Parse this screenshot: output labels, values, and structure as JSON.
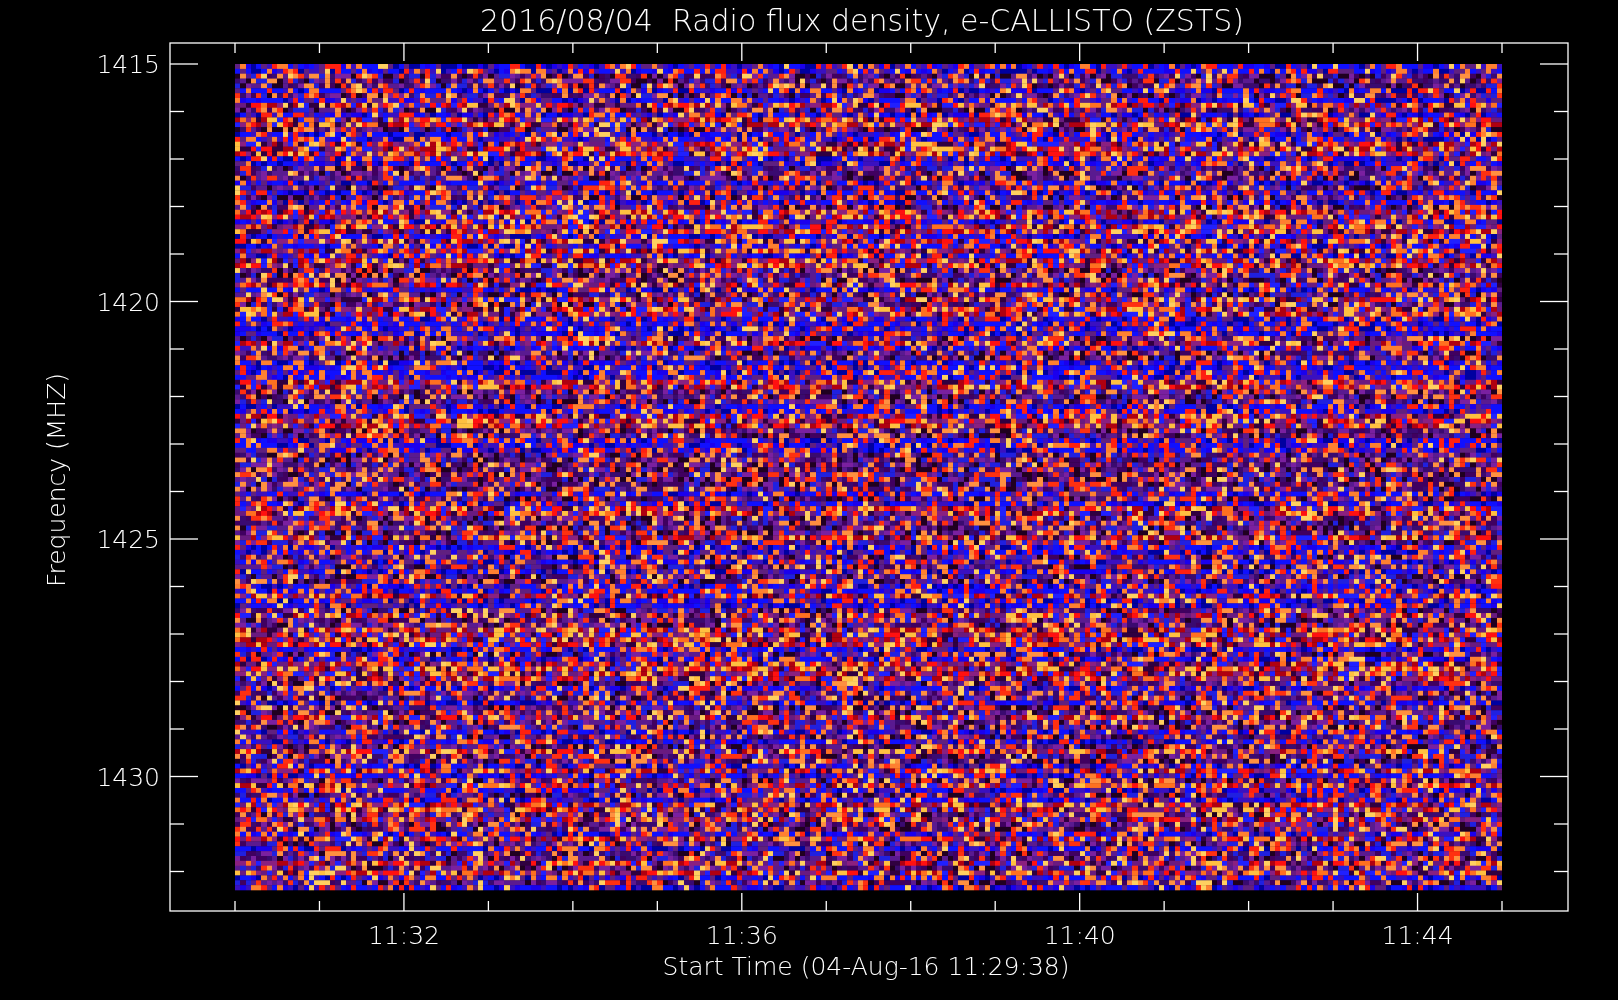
{
  "title": "2016/08/04  Radio flux density, e-CALLISTO (ZSTS)",
  "plot": {
    "ylabel": "Frequency (MHZ)",
    "xlabel": "Start Time (04-Aug-16 11:29:38)",
    "yticks": [
      "1415",
      "1420",
      "1425",
      "1430"
    ],
    "xticks": [
      "11:32",
      "11:36",
      "11:40",
      "11:44"
    ]
  }
}
